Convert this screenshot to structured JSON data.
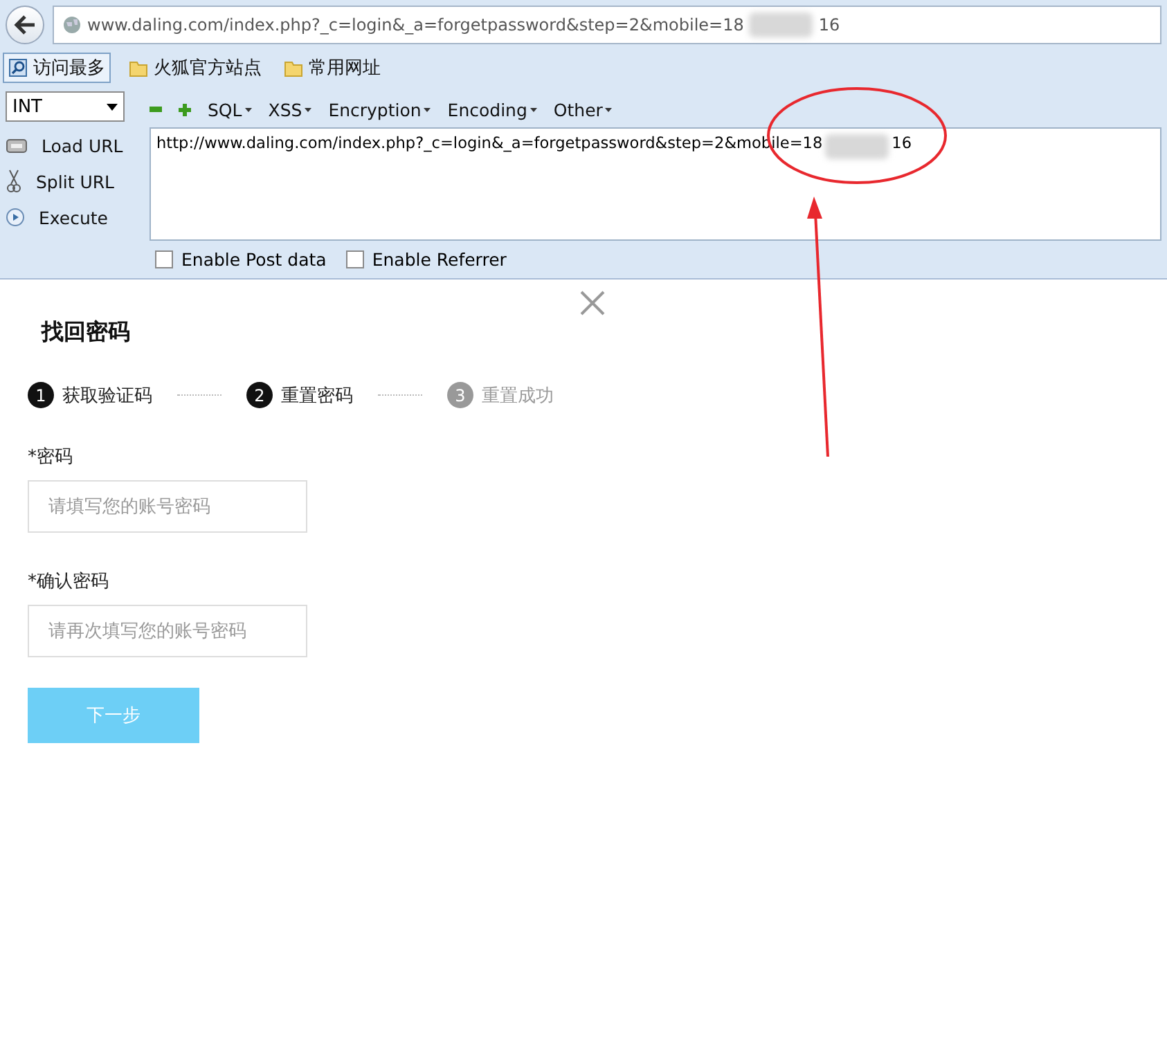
{
  "address_bar": {
    "url_shown": "www.daling.com/index.php?_c=login&_a=forgetpassword&step=2&mobile=18",
    "url_tail": "16"
  },
  "bookmarks": [
    {
      "label": "访问最多",
      "kind": "search"
    },
    {
      "label": "火狐官方站点",
      "kind": "folder"
    },
    {
      "label": "常用网址",
      "kind": "folder"
    }
  ],
  "hackbar": {
    "select": "INT",
    "menus": [
      "SQL",
      "XSS",
      "Encryption",
      "Encoding",
      "Other"
    ],
    "actions": [
      {
        "label": "Load URL",
        "kind": "load"
      },
      {
        "label": "Split URL",
        "kind": "split"
      },
      {
        "label": "Execute",
        "kind": "execute"
      }
    ],
    "url_shown": "http://www.daling.com/index.php?_c=login&_a=forgetpassword&step=2&mobile=18",
    "url_tail": "16",
    "options": [
      {
        "label": "Enable Post data",
        "checked": false
      },
      {
        "label": "Enable Referrer",
        "checked": false
      }
    ]
  },
  "dialog": {
    "title": "找回密码",
    "steps": [
      {
        "number": "1",
        "label": "获取验证码",
        "active": true
      },
      {
        "number": "2",
        "label": "重置密码",
        "active": true
      },
      {
        "number": "3",
        "label": "重置成功",
        "active": false
      }
    ],
    "fields": [
      {
        "label": "*密码",
        "placeholder": "请填写您的账号密码"
      },
      {
        "label": "*确认密码",
        "placeholder": "请再次填写您的账号密码"
      }
    ],
    "button": "下一步"
  }
}
